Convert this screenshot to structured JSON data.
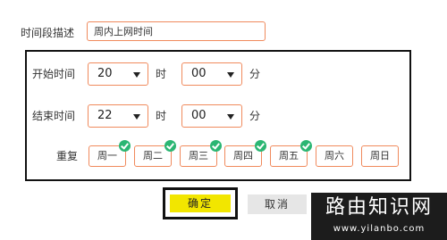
{
  "description": {
    "label": "时间段描述",
    "value": "周内上网时间"
  },
  "start": {
    "label": "开始时间",
    "hour": "20",
    "hour_unit": "时",
    "minute": "00",
    "minute_unit": "分"
  },
  "end": {
    "label": "结束时间",
    "hour": "22",
    "hour_unit": "时",
    "minute": "00",
    "minute_unit": "分"
  },
  "repeat": {
    "label": "重复",
    "days": [
      {
        "label": "周一",
        "selected": true
      },
      {
        "label": "周二",
        "selected": true
      },
      {
        "label": "周三",
        "selected": true
      },
      {
        "label": "周四",
        "selected": true
      },
      {
        "label": "周五",
        "selected": true
      },
      {
        "label": "周六",
        "selected": false
      },
      {
        "label": "周日",
        "selected": false
      }
    ]
  },
  "buttons": {
    "confirm": "确定",
    "cancel": "取消"
  },
  "watermark": {
    "title": "路由知识网",
    "url": "www.yilanbo.com"
  },
  "colors": {
    "field_border": "#f08a5d",
    "confirm_bg": "#f2e600",
    "check": "#2bb673",
    "cancel_bg": "#e6e6e6"
  }
}
